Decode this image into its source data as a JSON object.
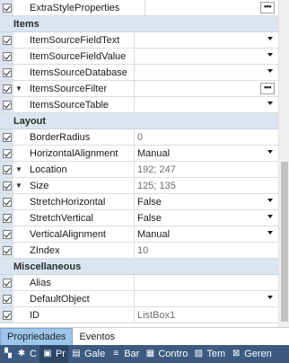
{
  "top_row": {
    "label": "ExtraStyleProperties",
    "ellipsis": "•••"
  },
  "categories": {
    "items": "Items",
    "layout": "Layout",
    "misc": "Miscellaneous"
  },
  "items_rows": [
    {
      "label": "ItemSourceFieldText",
      "value": ""
    },
    {
      "label": "ItemSourceFieldValue",
      "value": ""
    },
    {
      "label": "ItemsSourceDatabase",
      "value": ""
    },
    {
      "label": "ItemsSourceFilter",
      "value": ""
    },
    {
      "label": "ItemsSourceTable",
      "value": ""
    }
  ],
  "layout_rows": [
    {
      "label": "BorderRadius",
      "value": "0"
    },
    {
      "label": "HorizontalAlignment",
      "value": "Manual"
    },
    {
      "label": "Location",
      "value": "192; 247"
    },
    {
      "label": "Size",
      "value": "125; 135"
    },
    {
      "label": "StretchHorizontal",
      "value": "False"
    },
    {
      "label": "StretchVertical",
      "value": "False"
    },
    {
      "label": "VerticalAlignment",
      "value": "Manual"
    },
    {
      "label": "ZIndex",
      "value": "10"
    }
  ],
  "misc_rows": [
    {
      "label": "Alias",
      "value": ""
    },
    {
      "label": "DefaultObject",
      "value": ""
    },
    {
      "label": "ID",
      "value": "ListBox1"
    }
  ],
  "tabs": [
    {
      "label": "Propriedades"
    },
    {
      "label": "Eventos"
    }
  ],
  "taskbar": [
    {
      "icon": "✱",
      "label": "C"
    },
    {
      "icon": "▣",
      "label": "Pr"
    },
    {
      "icon": "▤",
      "label": "Gale"
    },
    {
      "icon": "≡",
      "label": "Bar"
    },
    {
      "icon": "▦",
      "label": "Contro"
    },
    {
      "icon": "▨",
      "label": "Tem"
    },
    {
      "icon": "⊠",
      "label": "Geren"
    }
  ],
  "colors": {
    "gutter": "#dbe5f1",
    "tab_active": "#9dc6ea",
    "taskbar": "#3d5a80"
  }
}
